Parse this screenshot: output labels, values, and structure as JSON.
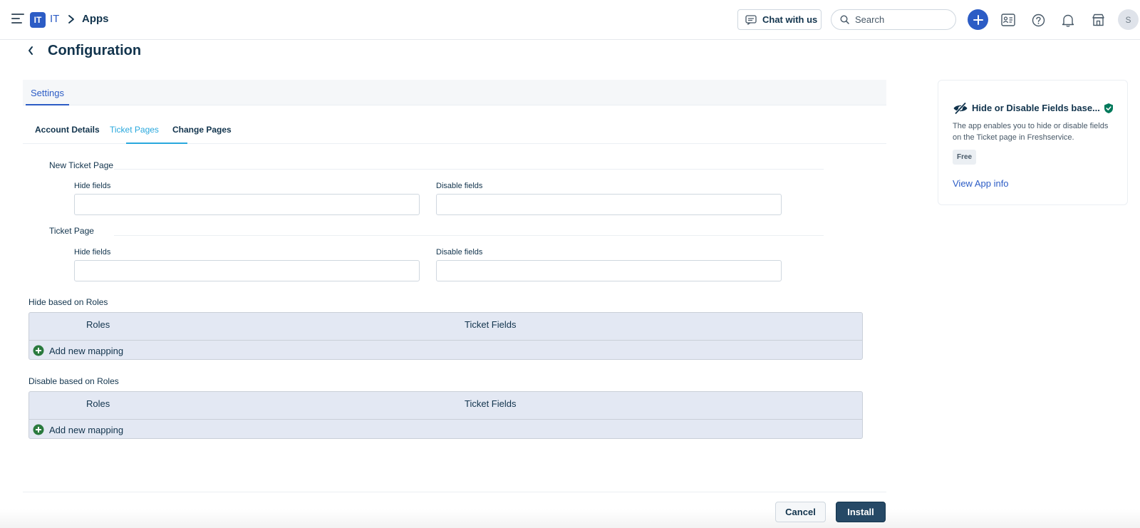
{
  "header": {
    "workspace_badge": "IT",
    "workspace_name": "IT",
    "breadcrumb_current": "Apps",
    "chat_label": "Chat with us",
    "search_placeholder": "Search",
    "avatar_initial": "S"
  },
  "page": {
    "title": "Configuration",
    "settings_tab": "Settings"
  },
  "subtabs": [
    "Account Details",
    "Ticket Pages",
    "Change Pages"
  ],
  "active_subtab": "Ticket Pages",
  "sections": [
    {
      "title": "New Ticket Page",
      "hide_label": "Hide fields",
      "disable_label": "Disable fields",
      "hide_value": "",
      "disable_value": ""
    },
    {
      "title": "Ticket Page",
      "hide_label": "Hide fields",
      "disable_label": "Disable fields",
      "hide_value": "",
      "disable_value": ""
    }
  ],
  "role_groups": [
    {
      "title": "Hide based on Roles",
      "col1": "Roles",
      "col2": "Ticket Fields",
      "add_label": "Add new mapping"
    },
    {
      "title": "Disable based on Roles",
      "col1": "Roles",
      "col2": "Ticket Fields",
      "add_label": "Add new mapping"
    }
  ],
  "footer": {
    "cancel": "Cancel",
    "install": "Install"
  },
  "app_card": {
    "name": "Hide or Disable Fields base...",
    "description": "The app enables you to hide or disable fields on the Ticket page in Freshservice.",
    "price": "Free",
    "view_link": "View App info"
  },
  "colors": {
    "brand_blue": "#2c5cc5",
    "active_tab": "#29a8dd",
    "install_button": "#264966",
    "add_icon_green": "#2a7a3e",
    "verified_green": "#00795b"
  },
  "icons": [
    "hamburger-icon",
    "chevron-right-icon",
    "chat-icon",
    "search-icon",
    "plus-icon",
    "contacts-icon",
    "help-icon",
    "bell-icon",
    "marketplace-icon",
    "back-chevron-icon",
    "eye-slash-icon",
    "verified-shield-icon",
    "add-circle-icon"
  ]
}
